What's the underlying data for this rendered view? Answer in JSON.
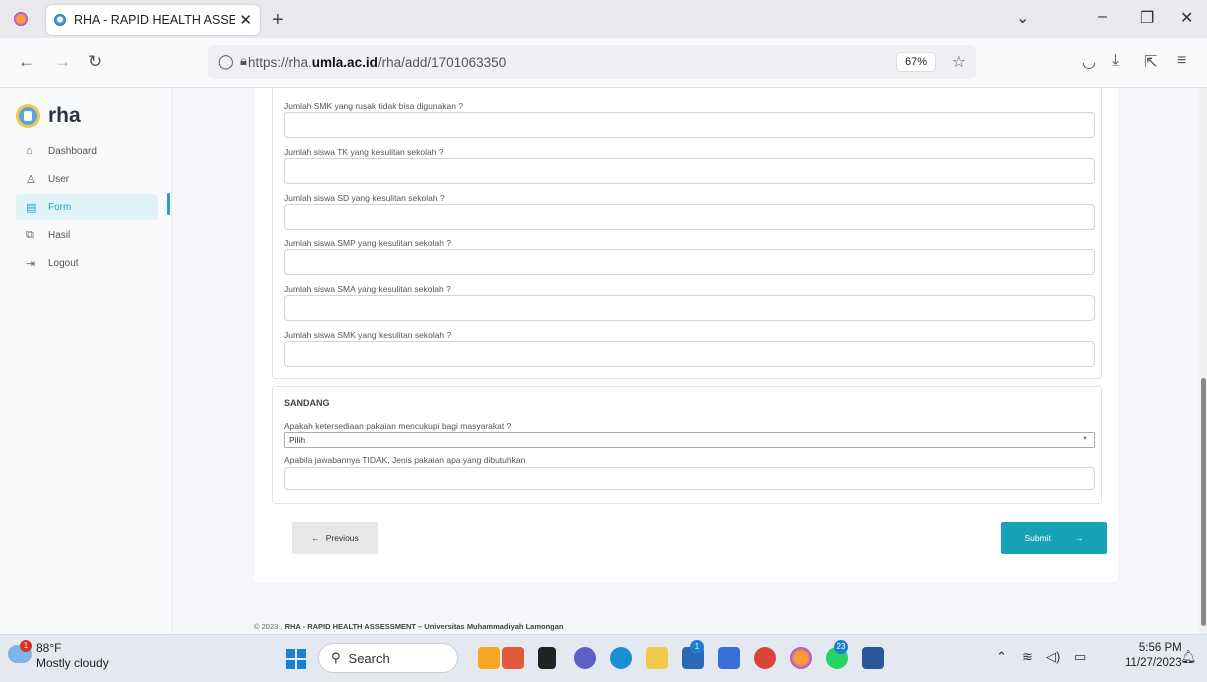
{
  "browser": {
    "tab_title": "RHA - RAPID HEALTH ASSESSM",
    "url_prefix": "https://rha.",
    "url_domain": "umla.ac.id",
    "url_path": "/rha/add/1701063350",
    "zoom": "67%"
  },
  "sidebar": {
    "brand": "rha",
    "items": [
      {
        "label": "Dashboard",
        "icon": "home-icon"
      },
      {
        "label": "User",
        "icon": "user-icon"
      },
      {
        "label": "Form",
        "icon": "form-icon"
      },
      {
        "label": "Hasil",
        "icon": "copy-icon"
      },
      {
        "label": "Logout",
        "icon": "logout-icon"
      }
    ]
  },
  "form": {
    "questions": [
      "Jumlah SMK yang rusak tidak bisa digunakan ?",
      "Jumlah siswa TK yang kesulitan sekolah ?",
      "Jumlah siswa SD yang kesulitan sekolah ?",
      "Jumlah siswa SMP yang kesulitan sekolah ?",
      "Jumlah siswa SMA yang kesulitan sekolah ?",
      "Jumlah siswa SMK yang kesulitan sekolah ?"
    ],
    "sandang": {
      "heading": "SANDANG",
      "q1": "Apakah ketersediaan pakaian mencukupi bagi masyarakat ?",
      "select_value": "Pilih",
      "q2": "Apabila jawabannya TIDAK, Jenis pakaian apa yang dibutuhkan"
    },
    "prev_label": "Previous",
    "submit_label": "Submit"
  },
  "footer": {
    "prefix": "© 2023 ,",
    "text": "RHA - RAPID HEALTH ASSESSMENT – Universitas Muhammadiyah Lamongan"
  },
  "taskbar": {
    "weather_temp": "88°F",
    "weather_desc": "Mostly cloudy",
    "weather_badge": "1",
    "search": "Search",
    "store_badge": "1",
    "whatsapp_badge": "23",
    "time": "5:56 PM",
    "date": "11/27/2023"
  }
}
